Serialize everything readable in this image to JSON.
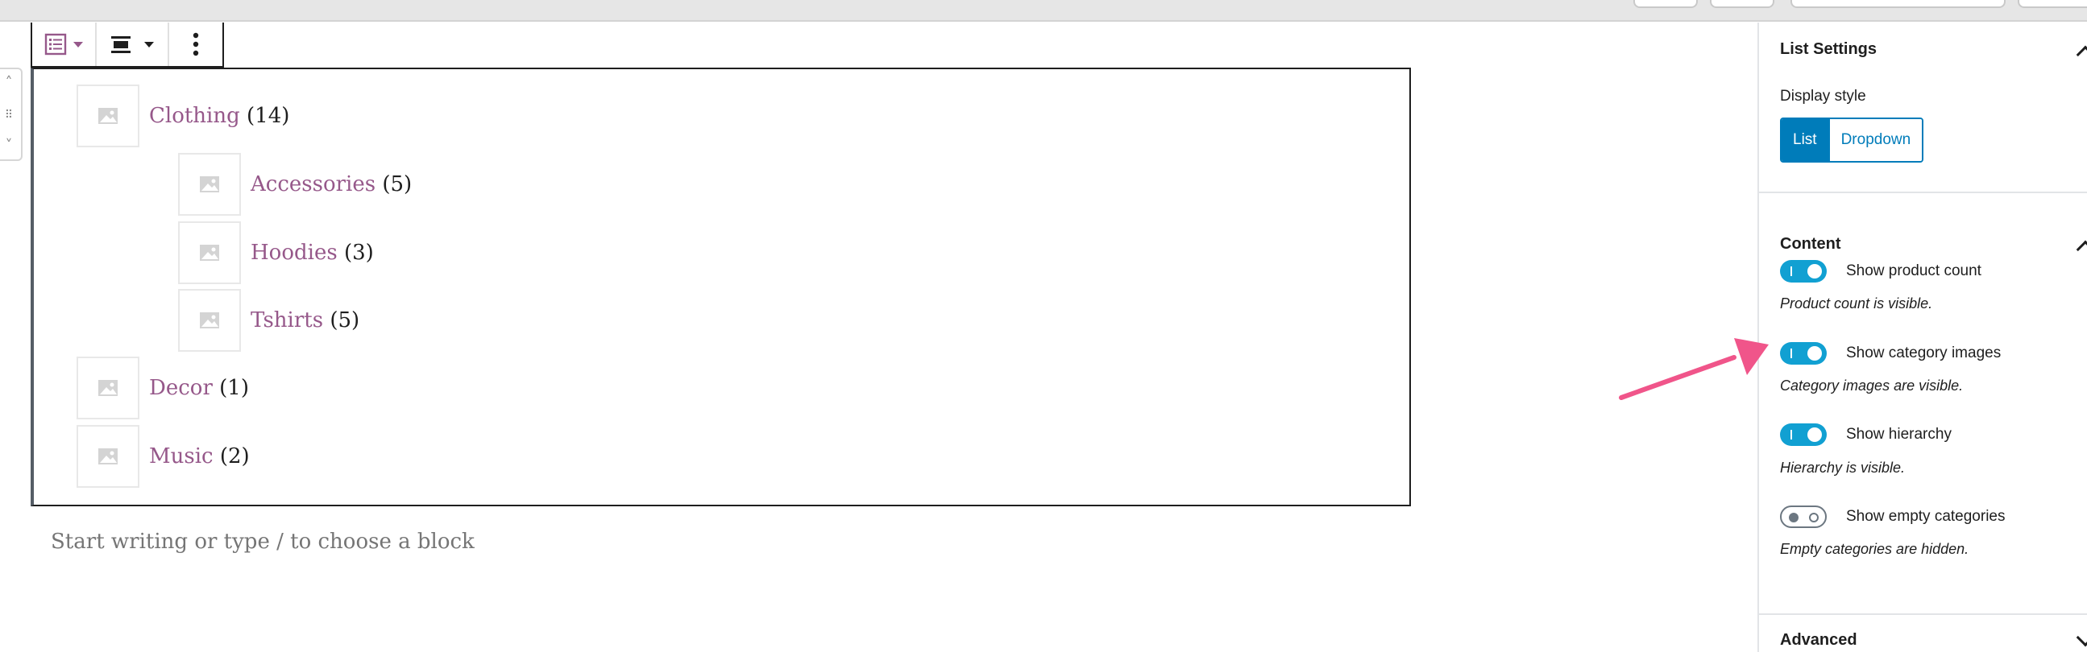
{
  "toolbar": {
    "list_view_icon": "list-view-icon",
    "align_icon": "align-icon",
    "more_icon": "more-options-icon"
  },
  "categories": [
    {
      "name": "Clothing",
      "count": "(14)"
    },
    {
      "name": "Accessories",
      "count": "(5)"
    },
    {
      "name": "Hoodies",
      "count": "(3)"
    },
    {
      "name": "Tshirts",
      "count": "(5)"
    },
    {
      "name": "Decor",
      "count": "(1)"
    },
    {
      "name": "Music",
      "count": "(2)"
    }
  ],
  "editor": {
    "placeholder": "Start writing or type / to choose a block"
  },
  "sidebar": {
    "list_settings": {
      "title": "List Settings",
      "display_style_label": "Display style",
      "options": [
        "List",
        "Dropdown"
      ],
      "selected": "List"
    },
    "content": {
      "title": "Content",
      "toggles": [
        {
          "label": "Show product count",
          "help": "Product count is visible.",
          "on": true
        },
        {
          "label": "Show category images",
          "help": "Category images are visible.",
          "on": true
        },
        {
          "label": "Show hierarchy",
          "help": "Hierarchy is visible.",
          "on": true
        },
        {
          "label": "Show empty categories",
          "help": "Empty categories are hidden.",
          "on": false
        }
      ]
    },
    "advanced": {
      "title": "Advanced"
    }
  },
  "colors": {
    "category_link": "#96588a",
    "toggle_on": "#11a0d2",
    "accent": "#007cba",
    "annotation_arrow": "#f0558a"
  }
}
